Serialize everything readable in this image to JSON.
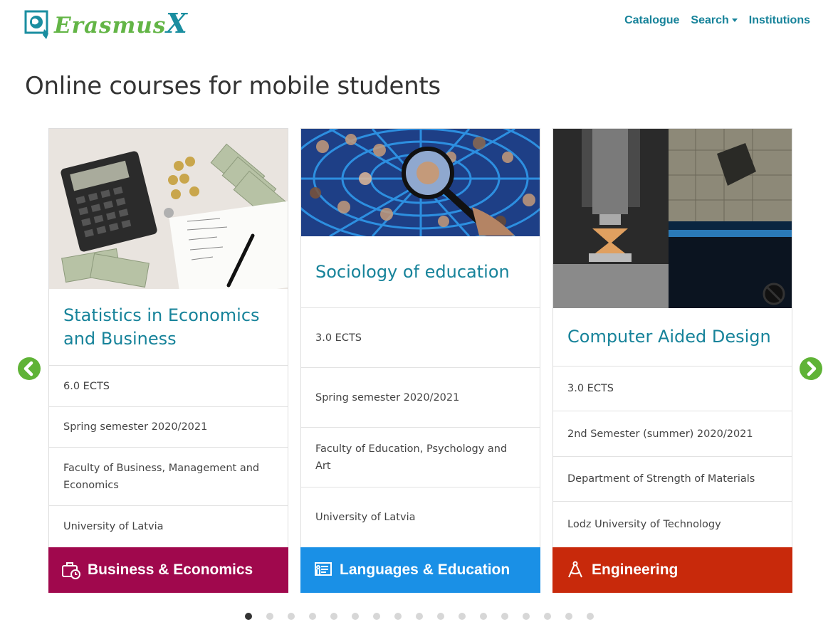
{
  "brand": {
    "name": "Erasmus",
    "suffix": "X"
  },
  "nav": {
    "catalogue": "Catalogue",
    "search": "Search",
    "institutions": "Institutions"
  },
  "page": {
    "title": "Online courses for mobile students"
  },
  "colors": {
    "accent": "#17839a",
    "arrow": "#5fb336",
    "business": "#a0084d",
    "languages": "#1a90e6",
    "engineering": "#c8290b"
  },
  "courses": [
    {
      "title": "Statistics in Economics and Business",
      "ects": "6.0 ECTS",
      "semester": "Spring semester 2020/2021",
      "faculty": "Faculty of Business, Management and Economics",
      "university": "University of Latvia",
      "category": "Business & Economics",
      "category_icon": "briefcase-clock-icon",
      "image": "calculator-money-photo"
    },
    {
      "title": "Sociology of education",
      "ects": "3.0 ECTS",
      "semester": "Spring semester 2020/2021",
      "faculty": "Faculty of Education, Psychology and Art",
      "university": "University of Latvia",
      "category": "Languages & Education",
      "category_icon": "certificate-icon",
      "image": "faces-magnifier-photo"
    },
    {
      "title": "Computer Aided Design",
      "ects": "3.0 ECTS",
      "semester": "2nd Semester (summer) 2020/2021",
      "faculty": "Department of Strength of Materials",
      "university": "Lodz University of Technology",
      "category": "Engineering",
      "category_icon": "compass-icon",
      "image": "material-testing-photo"
    }
  ],
  "carousel": {
    "total_slides": 17,
    "active_slide": 1
  }
}
